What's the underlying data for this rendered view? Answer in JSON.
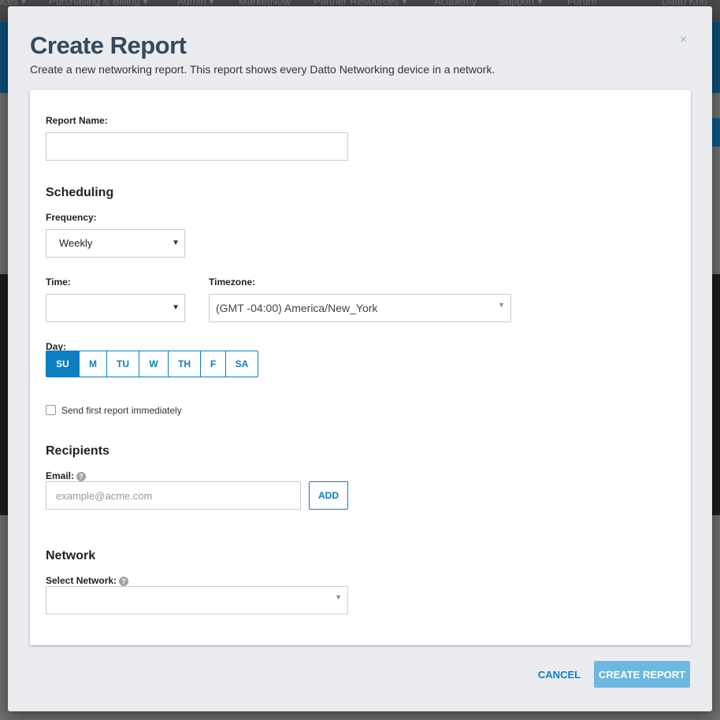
{
  "background": {
    "nav_items": [
      "ices ▾",
      "Purchasing & Billing ▾",
      "Admin ▾",
      "MarketNow",
      "Partner Resources ▾",
      "Academy",
      "Support ▾",
      "Forum",
      "Datto Kno"
    ]
  },
  "modal": {
    "title": "Create Report",
    "description": "Create a new networking report. This report shows every Datto Networking device in a network.",
    "close_glyph": "×"
  },
  "form": {
    "report_name_label": "Report Name:",
    "report_name_value": "",
    "scheduling_heading": "Scheduling",
    "frequency_label": "Frequency:",
    "frequency_value": "Weekly",
    "time_label": "Time:",
    "time_value": "",
    "timezone_label": "Timezone:",
    "timezone_value": "(GMT -04:00) America/New_York",
    "day_label": "Day:",
    "days": [
      "SU",
      "M",
      "TU",
      "W",
      "TH",
      "F",
      "SA"
    ],
    "selected_day": "SU",
    "send_immediately_label": "Send first report immediately",
    "send_immediately_checked": false,
    "recipients_heading": "Recipients",
    "email_label": "Email:",
    "email_placeholder": "example@acme.com",
    "add_label": "ADD",
    "network_heading": "Network",
    "select_network_label": "Select Network:",
    "select_network_value": ""
  },
  "footer": {
    "cancel_label": "CANCEL",
    "create_label": "CREATE REPORT"
  },
  "icons": {
    "caret": "▼",
    "help": "?"
  },
  "colors": {
    "accent": "#0b7fc1",
    "primary_disabled": "#6cb8e0",
    "title": "#34495e"
  }
}
